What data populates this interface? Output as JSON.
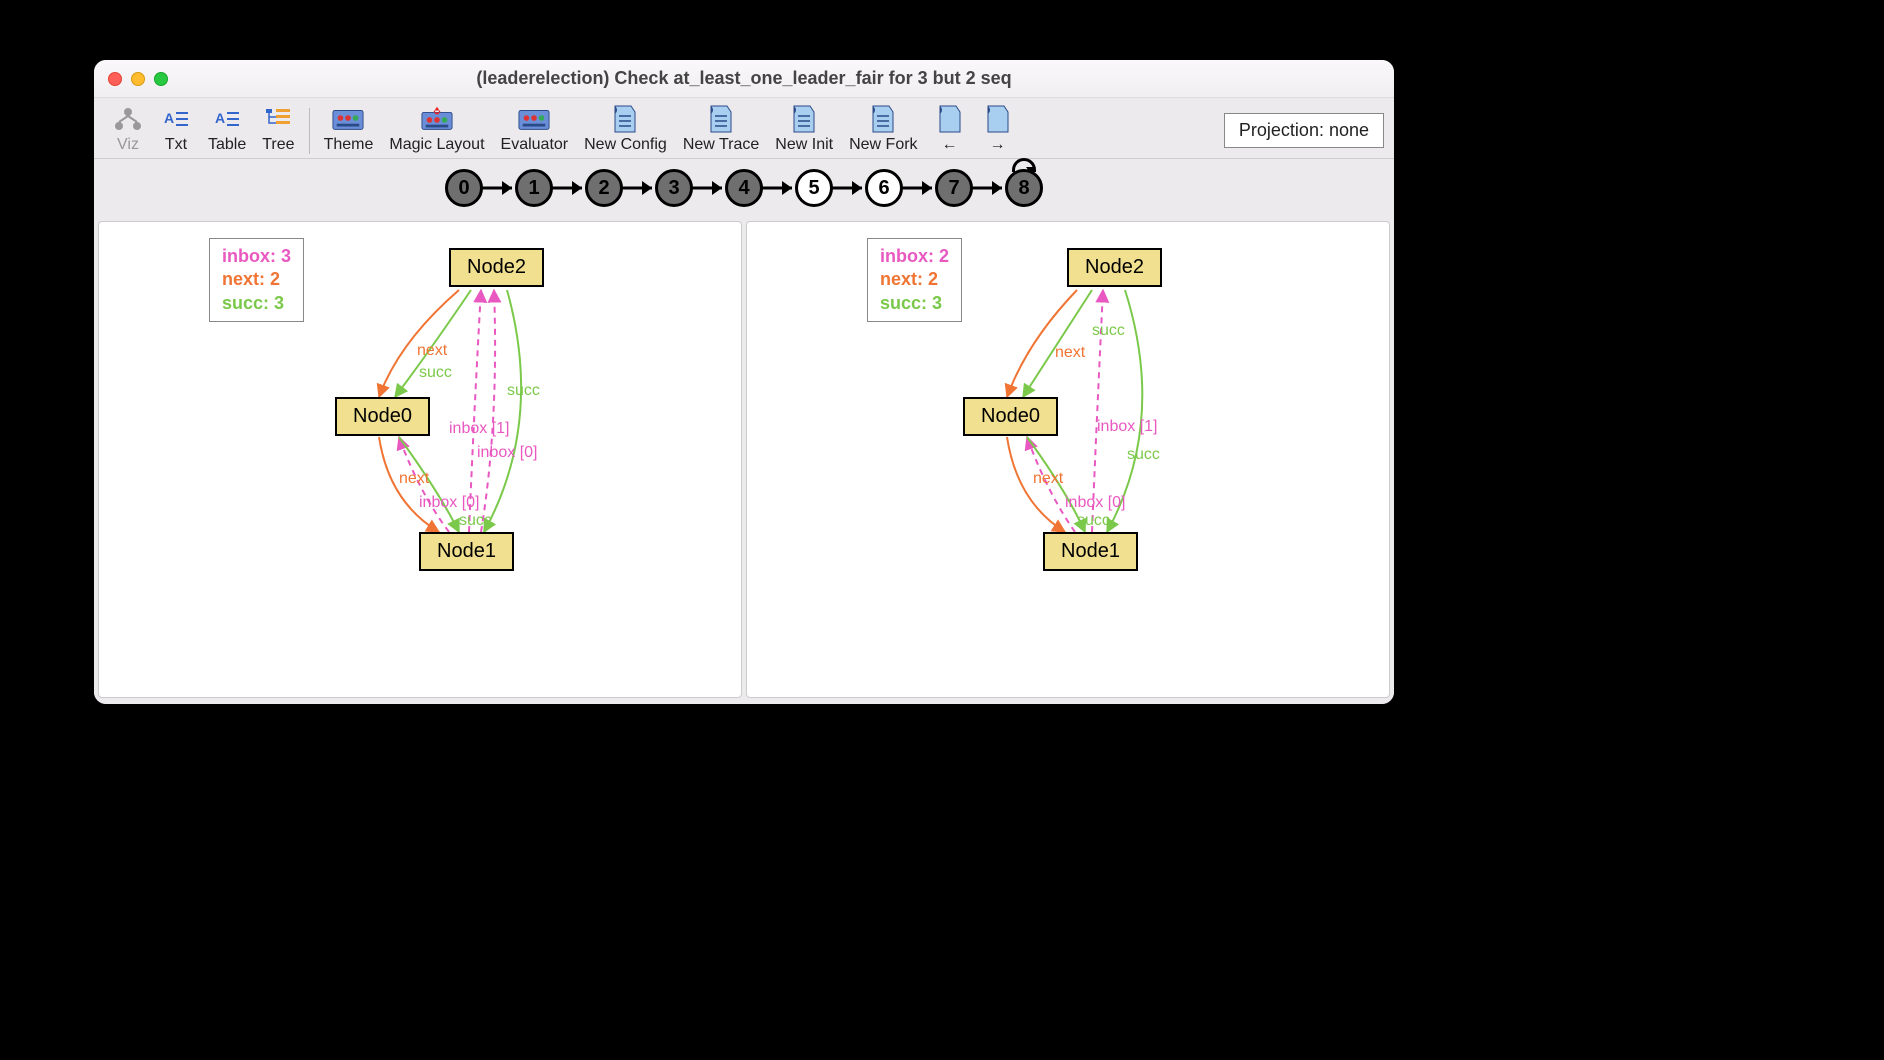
{
  "window": {
    "title": "(leaderelection) Check at_least_one_leader_fair for 3 but 2 seq"
  },
  "toolbar": {
    "viz": "Viz",
    "txt": "Txt",
    "table": "Table",
    "tree": "Tree",
    "theme": "Theme",
    "magic_layout": "Magic Layout",
    "evaluator": "Evaluator",
    "new_config": "New Config",
    "new_trace": "New Trace",
    "new_init": "New Init",
    "new_fork": "New Fork",
    "prev": "←",
    "next": "→",
    "projection_label": "Projection: none"
  },
  "states": [
    "0",
    "1",
    "2",
    "3",
    "4",
    "5",
    "6",
    "7",
    "8"
  ],
  "state_open": [
    false,
    false,
    false,
    false,
    false,
    true,
    true,
    false,
    false
  ],
  "loop_on": 8,
  "left_pane": {
    "legend": {
      "inbox": "inbox: 3",
      "next": "next: 2",
      "succ": "succ: 3"
    },
    "nodes": {
      "n2": "Node2",
      "n0": "Node0",
      "n1": "Node1"
    },
    "edge_labels": {
      "e_next_20": "next",
      "e_succ_20": "succ",
      "e_succ_21": "succ",
      "e_inbox1": "inbox [1]",
      "e_inbox0a": "inbox [0]",
      "e_next_01": "next",
      "e_inbox0b": "inbox [0]",
      "e_succ_01": "succ"
    }
  },
  "right_pane": {
    "legend": {
      "inbox": "inbox: 2",
      "next": "next: 2",
      "succ": "succ: 3"
    },
    "nodes": {
      "n2": "Node2",
      "n0": "Node0",
      "n1": "Node1"
    },
    "edge_labels": {
      "e_next_20": "next",
      "e_succ_20": "succ",
      "e_inbox1": "inbox [1]",
      "e_succ_21": "succ",
      "e_next_01": "next",
      "e_inbox0": "inbox [0]",
      "e_succ_01": "succ"
    }
  }
}
